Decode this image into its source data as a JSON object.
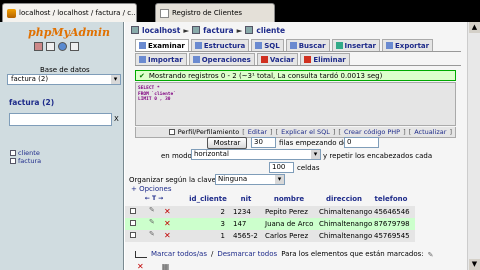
{
  "browser": {
    "tabs": [
      {
        "label": "localhost / localhost / factura / c...",
        "active": true
      },
      {
        "label": "Registro de Clientes",
        "active": false
      }
    ]
  },
  "sidebar": {
    "logo_text": "phpMyAdmin",
    "db_label": "Base de datos",
    "db_selected": "factura (2)",
    "db_heading": "factura (2)",
    "filter_clear": "X",
    "tables": [
      "cliente",
      "factura"
    ]
  },
  "breadcrumb": {
    "server": "localhost",
    "database": "factura",
    "table": "cliente",
    "sep": "►"
  },
  "tabs": {
    "row1": [
      "Examinar",
      "Estructura",
      "SQL",
      "Buscar",
      "Insertar",
      "Exportar"
    ],
    "row2": [
      "Importar",
      "Operaciones",
      "Vaciar",
      "Eliminar"
    ]
  },
  "notice": "Mostrando registros 0 - 2 (~3¹ total, La consulta tardó 0.0013 seg)",
  "sql": {
    "line1": "SELECT *",
    "line2": "FROM `cliente`",
    "line3": "LIMIT 0 , 30"
  },
  "sql_links": {
    "profiling": "Perfil/Perfilamiento",
    "edit": "Editar",
    "explain": "Explicar el SQL",
    "create_php": "Crear código PHP",
    "refresh": "Actualizar"
  },
  "nav": {
    "show_button": "Mostrar",
    "rows_value": "30",
    "rows_from_label": "filas empezando de",
    "start_value": "0",
    "mode_label": "en modo",
    "mode_value": "horizontal",
    "repeat_label": "y repetir los encabezados cada",
    "repeat_value": "100",
    "cells_label": "celdas",
    "sort_label": "Organizar según la clave:",
    "sort_value": "Ninguna",
    "options_link": "+ Opciones"
  },
  "results": {
    "columns": [
      "id_cliente",
      "nit",
      "nombre",
      "direccion",
      "telefono"
    ],
    "sort_arrows": "← T →",
    "rows": [
      {
        "id_cliente": "2",
        "nit": "1234",
        "nombre": "Pepito Perez",
        "direccion": "Chimaltenango",
        "telefono": "45646546"
      },
      {
        "id_cliente": "3",
        "nit": "147",
        "nombre": "Juana de Arco",
        "direccion": "Chimaltenango",
        "telefono": "87679798"
      },
      {
        "id_cliente": "1",
        "nit": "4565-2",
        "nombre": "Carlos Perez",
        "direccion": "Chimaltenango",
        "telefono": "45769545"
      }
    ]
  },
  "footer": {
    "mark_all": "Marcar todos/as",
    "sep": "/",
    "unmark_all": "Desmarcar todos",
    "for_marked": "Para los elementos que están marcados:"
  }
}
